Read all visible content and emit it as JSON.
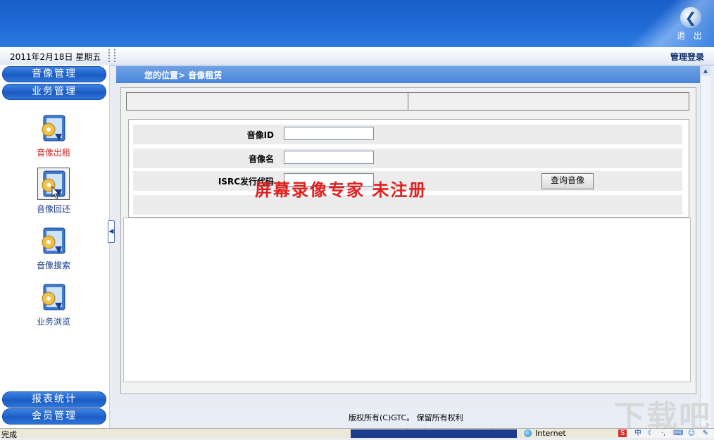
{
  "header": {
    "exit_label": "退 出"
  },
  "infobar": {
    "date": "2011年2月18日 星期五",
    "admin_login": "管理登录"
  },
  "sidebar": {
    "menu_top": [
      "音像管理",
      "业务管理"
    ],
    "nav_items": [
      "音像出租",
      "音像回还",
      "音像搜索",
      "业务浏览"
    ],
    "menu_bottom": [
      "报表统计",
      "会员管理"
    ]
  },
  "breadcrumb": "您的位置> 音像租赁",
  "form": {
    "label_id": "音像ID",
    "label_name": "音像名",
    "label_isrc": "ISRC发行代码",
    "query_button": "查询音像"
  },
  "watermark": "屏幕录像专家  未注册",
  "footer": {
    "copyright": "版权所有(C)GTC。 保留所有权利"
  },
  "statusbar": {
    "status": "完成",
    "zone": "Internet"
  },
  "tray": {
    "s_label": "S",
    "ime_label": "中"
  },
  "site_mark": "下载吧"
}
